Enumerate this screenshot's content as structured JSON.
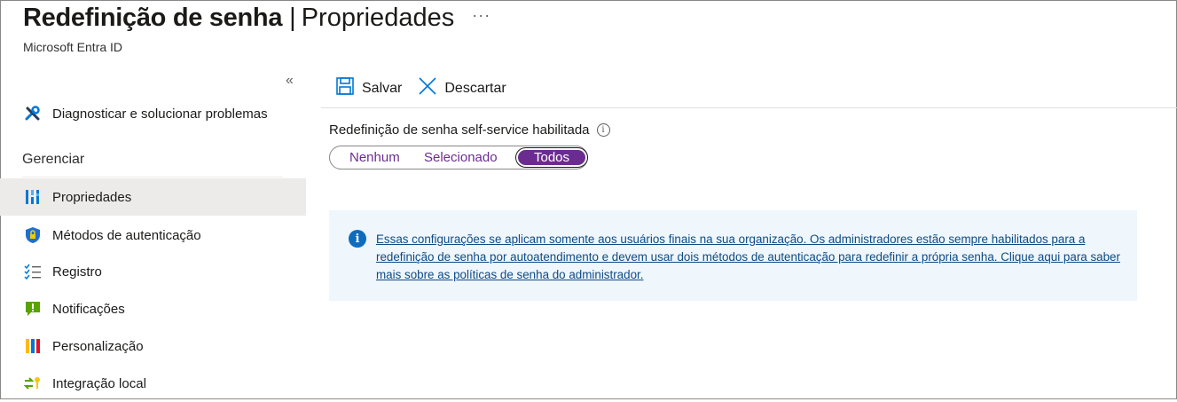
{
  "header": {
    "title": "Redefinição de senha",
    "separator": "|",
    "page": "Propriedades",
    "more": "···",
    "subtitle": "Microsoft Entra ID"
  },
  "sidebar": {
    "collapse": "«",
    "top_item": {
      "label": "Diagnosticar e solucionar problemas",
      "icon": "tools-icon"
    },
    "section": "Gerenciar",
    "items": [
      {
        "label": "Propriedades",
        "icon": "properties-icon",
        "selected": true
      },
      {
        "label": "Métodos de autenticação",
        "icon": "shield-icon"
      },
      {
        "label": "Registro",
        "icon": "checklist-icon"
      },
      {
        "label": "Notificações",
        "icon": "notification-icon"
      },
      {
        "label": "Personalização",
        "icon": "customization-icon"
      },
      {
        "label": "Integração local",
        "icon": "sync-key-icon"
      }
    ]
  },
  "toolbar": {
    "save_label": "Salvar",
    "discard_label": "Descartar"
  },
  "sspr": {
    "label": "Redefinição de senha self-service habilitada",
    "info": "i",
    "options": [
      "Nenhum",
      "Selecionado",
      "Todos"
    ],
    "selected": "Todos"
  },
  "banner": {
    "icon": "i",
    "text": "Essas configurações se aplicam somente aos usuários finais na sua organização. Os administradores estão sempre habilitados para a redefinição de senha por autoatendimento e devem usar dois métodos de autenticação para redefinir a própria senha. Clique aqui para saber mais sobre as políticas de senha do administrador."
  },
  "colors": {
    "accent": "#6b2c91",
    "link": "#0f4a85",
    "banner_bg": "#eff6fc",
    "selected_nav_bg": "#edebe9"
  }
}
